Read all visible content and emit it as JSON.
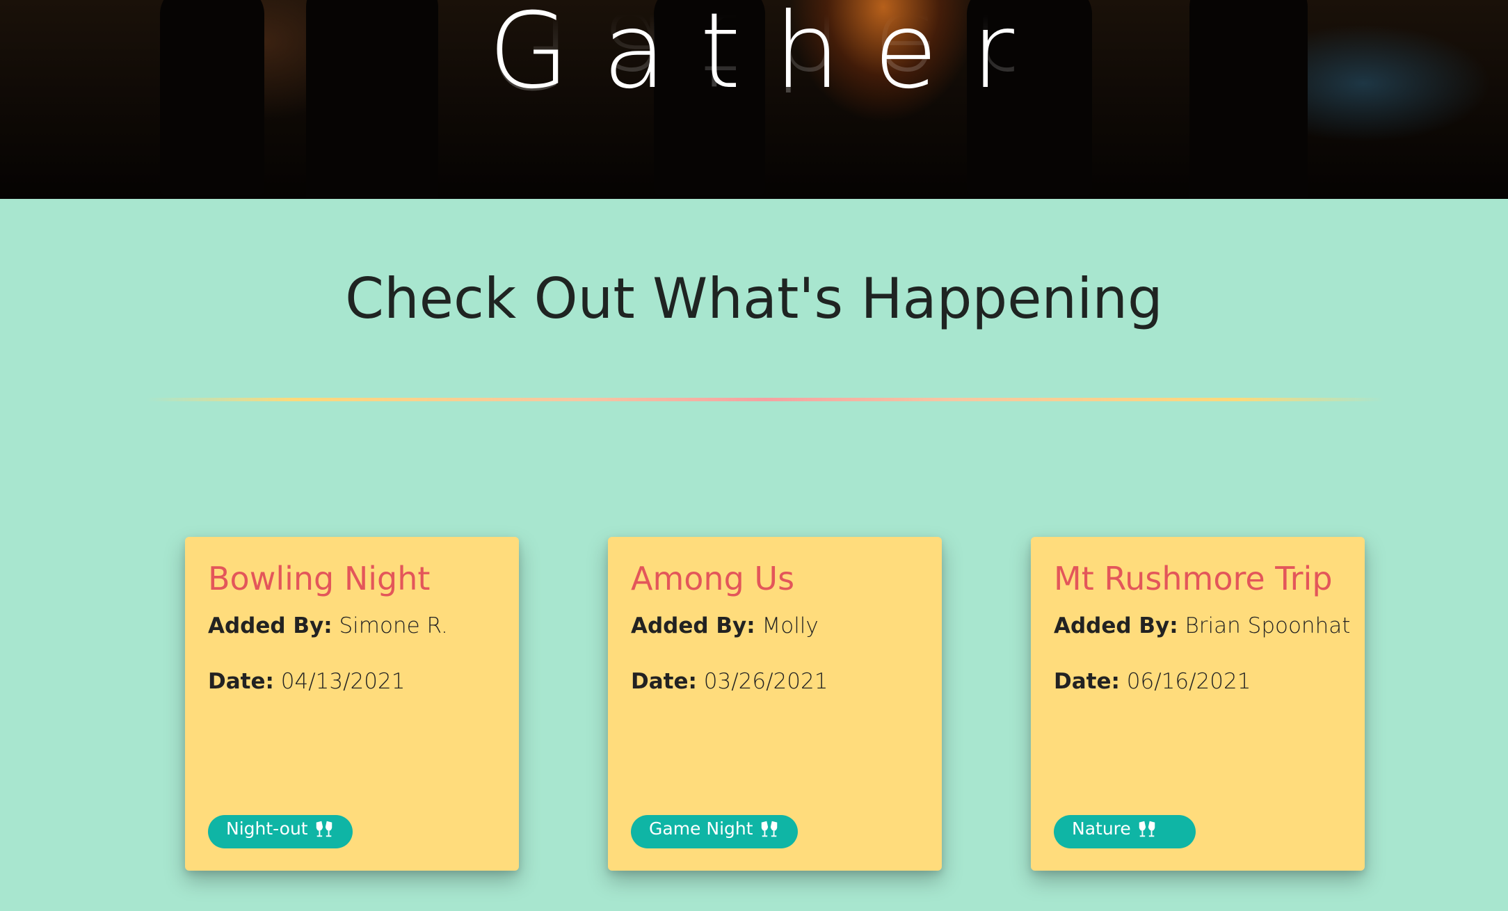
{
  "hero": {
    "title": "Gather"
  },
  "section": {
    "title": "Check Out What's Happening"
  },
  "events": [
    {
      "title": "Bowling Night",
      "added_by_label": "Added By:",
      "added_by": "Simone R.",
      "date_label": "Date:",
      "date": "04/13/2021",
      "tag": "Night-out"
    },
    {
      "title": "Among Us",
      "added_by_label": "Added By:",
      "added_by": "Molly",
      "date_label": "Date:",
      "date": "03/26/2021",
      "tag": "Game Night"
    },
    {
      "title": "Mt Rushmore Trip",
      "added_by_label": "Added By:",
      "added_by": "Brian Spoonhat",
      "date_label": "Date:",
      "date": "06/16/2021",
      "tag": "Nature"
    }
  ],
  "icons": {
    "tag_icon": "glasses-cheers-icon"
  },
  "colors": {
    "background": "#a8e6cf",
    "card": "#ffdc7c",
    "card_title": "#e3565a",
    "tag": "#0fb5a5",
    "text": "#1f2422"
  }
}
